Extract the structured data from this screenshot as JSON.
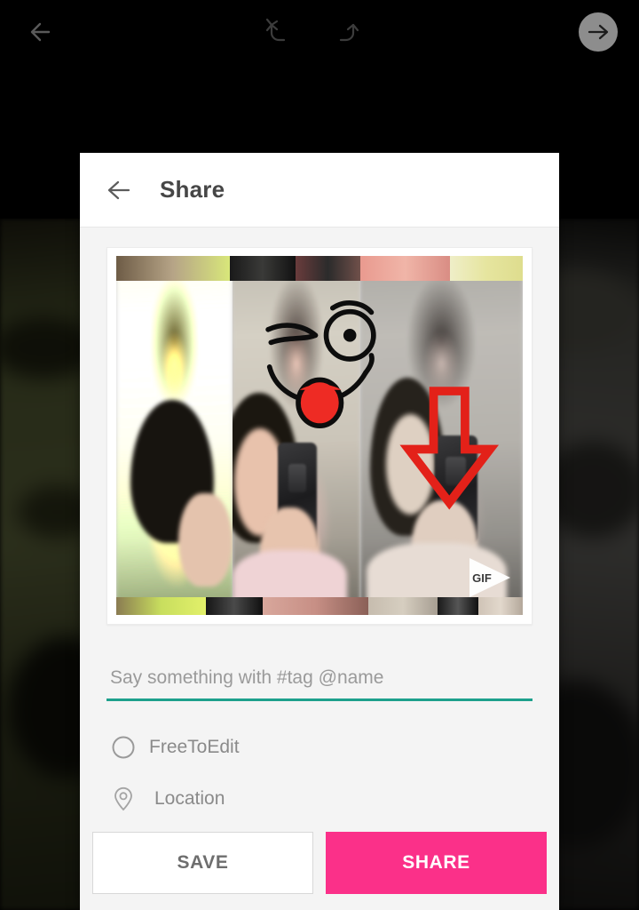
{
  "editor_toolbar": {
    "back_icon": "arrow-left-icon",
    "undo_icon": "undo-icon",
    "redo_icon": "redo-icon",
    "next_icon": "arrow-right-circle-icon"
  },
  "share_dialog": {
    "back_icon": "arrow-left-icon",
    "title": "Share",
    "preview": {
      "media_type": "gif",
      "gif_badge_label": "GIF",
      "gif_badge_icon": "play-triangle-icon",
      "stickers": [
        {
          "name": "winking-tongue-face-sticker",
          "color": "#000000",
          "tongue_color": "#ee2b24"
        },
        {
          "name": "red-down-arrow-sticker",
          "color": "#e32119"
        }
      ]
    },
    "caption": {
      "value": "",
      "placeholder": "Say something with #tag @name",
      "underline_color": "#1da08c"
    },
    "options": [
      {
        "name": "freetoedit",
        "label": "FreeToEdit",
        "icon": "radio-unchecked-icon",
        "checked": false
      },
      {
        "name": "location",
        "label": "Location",
        "icon": "map-pin-icon"
      }
    ],
    "footer": {
      "save_label": "SAVE",
      "share_label": "SHARE",
      "share_color": "#fb3089",
      "save_text_color": "#6e6e6e"
    }
  }
}
